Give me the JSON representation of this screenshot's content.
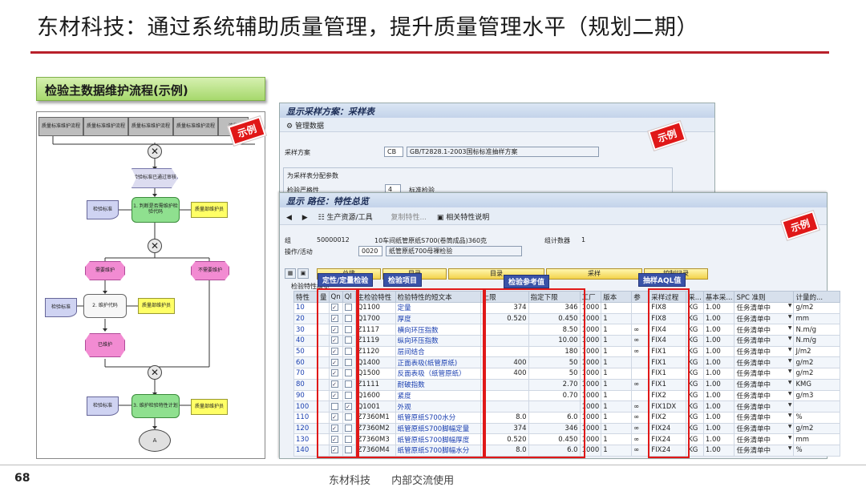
{
  "slide": {
    "title": "东材科技：通过系统辅助质量管理，提升质量管理水平（规划二期）",
    "section_label": "检验主数据维护流程(示例)",
    "page_number": "68",
    "footer_company": "东材科技",
    "footer_note": "内部交流使用",
    "accent_color": "#b8202a"
  },
  "stamp_text": "示例",
  "flowchart": {
    "top_events": [
      "质量标准维护流程",
      "质量标准维护流程",
      "质量标准维护流程",
      "质量标准维护流程",
      "流程"
    ],
    "start_event": "检验标准已通过审核",
    "func1": "1. 判断是否需维护检验代码",
    "doc1": "检验标准",
    "org1": "质量部维护员",
    "need_maintain": "需要维护",
    "no_maintain": "不需要维护",
    "func2": "2. 维护代码",
    "doc2": "检验标准",
    "org2": "质量部维护员",
    "maintained": "已维护",
    "func3": "3. 维护检验特性计划",
    "doc3": "检验标准",
    "org3": "质量部维护员",
    "end_connector": "A",
    "xor_symbol": "✕"
  },
  "sampling_window": {
    "title": "显示采样方案：采样表",
    "toolbar_item": "管理数据",
    "scheme_label": "采样方案",
    "scheme_code": "CB",
    "scheme_desc": "GB/T2828.1-2003国标标准抽样方案",
    "group_label": "为采样表分配参数",
    "severity_label": "检验严格性",
    "severity_code": "4",
    "severity_value": "标准检验"
  },
  "routing_window": {
    "title": "显示 路径：特性总览",
    "toolbar": {
      "prod_resources": "生产资源/工具",
      "copy_char": "复制特性...",
      "related_char": "相关特性说明"
    },
    "group_label": "组",
    "group_value": "50000012",
    "group_desc": "10车间纸管原纸S700(卷筒成品)360克",
    "counter_label": "组计数器",
    "counter_value": "1",
    "op_label": "操作/活动",
    "op_value": "0020",
    "op_desc": "纸管原纸700母裸检验",
    "button_general": "总揽",
    "button_catalog": "目录",
    "button_sampling": "采样",
    "button_control": "控制记录",
    "grid_section": "检验特性概览",
    "callouts": {
      "qual_quant": "定性/定量检验",
      "inspection_item": "检验项目",
      "ref_values": "检验参考值",
      "aql": "抽样AQL值"
    },
    "columns": [
      "特性",
      "量",
      "Qn",
      "Ql",
      "主检验特性",
      "检验特性的短文本",
      "上限",
      "指定下限",
      "工厂",
      "版本",
      "参",
      "采样过程",
      "采...",
      "基本采...",
      "SPC 准则",
      "计量的..."
    ],
    "rows": [
      {
        "id": "10",
        "qn": "✓",
        "ql": "",
        "code": "Q1100",
        "text": "定量",
        "upper": "374",
        "lower": "346",
        "plant": "1000",
        "ver": "1",
        "ref": "",
        "proc": "FIX8",
        "unit": "KG",
        "base": "1.00",
        "spc": "任务清单中",
        "meas": "g/m2"
      },
      {
        "id": "20",
        "qn": "✓",
        "ql": "",
        "code": "Q1700",
        "text": "厚度",
        "upper": "0.520",
        "lower": "0.450",
        "plant": "1000",
        "ver": "1",
        "ref": "",
        "proc": "FIX8",
        "unit": "KG",
        "base": "1.00",
        "spc": "任务清单中",
        "meas": "mm"
      },
      {
        "id": "30",
        "qn": "✓",
        "ql": "",
        "code": "Z1117",
        "text": "横向环压指数",
        "upper": "",
        "lower": "8.50",
        "plant": "1000",
        "ver": "1",
        "ref": "∞",
        "proc": "FIX4",
        "unit": "KG",
        "base": "1.00",
        "spc": "任务清单中",
        "meas": "N.m/g"
      },
      {
        "id": "40",
        "qn": "✓",
        "ql": "",
        "code": "Z1119",
        "text": "纵向环压指数",
        "upper": "",
        "lower": "10.00",
        "plant": "1000",
        "ver": "1",
        "ref": "∞",
        "proc": "FIX4",
        "unit": "KG",
        "base": "1.00",
        "spc": "任务清单中",
        "meas": "N.m/g"
      },
      {
        "id": "50",
        "qn": "✓",
        "ql": "",
        "code": "Z1120",
        "text": "层间结合",
        "upper": "",
        "lower": "180",
        "plant": "1000",
        "ver": "1",
        "ref": "∞",
        "proc": "FIX1",
        "unit": "KG",
        "base": "1.00",
        "spc": "任务清单中",
        "meas": "J/m2"
      },
      {
        "id": "60",
        "qn": "✓",
        "ql": "",
        "code": "Q1400",
        "text": "正面表吸(纸管原纸)",
        "upper": "400",
        "lower": "50",
        "plant": "1000",
        "ver": "1",
        "ref": "",
        "proc": "FIX1",
        "unit": "KG",
        "base": "1.00",
        "spc": "任务清单中",
        "meas": "g/m2"
      },
      {
        "id": "70",
        "qn": "✓",
        "ql": "",
        "code": "Q1500",
        "text": "反面表吸（纸管原纸）",
        "upper": "400",
        "lower": "50",
        "plant": "1000",
        "ver": "1",
        "ref": "",
        "proc": "FIX1",
        "unit": "KG",
        "base": "1.00",
        "spc": "任务清单中",
        "meas": "g/m2"
      },
      {
        "id": "80",
        "qn": "✓",
        "ql": "",
        "code": "Z1111",
        "text": "耐破指数",
        "upper": "",
        "lower": "2.70",
        "plant": "1000",
        "ver": "1",
        "ref": "∞",
        "proc": "FIX1",
        "unit": "KG",
        "base": "1.00",
        "spc": "任务清单中",
        "meas": "KMG"
      },
      {
        "id": "90",
        "qn": "✓",
        "ql": "",
        "code": "Q1600",
        "text": "紧度",
        "upper": "",
        "lower": "0.70",
        "plant": "1000",
        "ver": "1",
        "ref": "",
        "proc": "FIX2",
        "unit": "KG",
        "base": "1.00",
        "spc": "任务清单中",
        "meas": "g/m3"
      },
      {
        "id": "100",
        "qn": "",
        "ql": "✓",
        "code": "Q1001",
        "text": "外观",
        "upper": "",
        "lower": "",
        "plant": "1000",
        "ver": "1",
        "ref": "∞",
        "proc": "FIX1DX",
        "unit": "KG",
        "base": "1.00",
        "spc": "任务清单中",
        "meas": ""
      },
      {
        "id": "110",
        "qn": "✓",
        "ql": "",
        "code": "Z7360M1",
        "text": "纸管原纸S700水分",
        "upper": "8.0",
        "lower": "6.0",
        "plant": "1000",
        "ver": "1",
        "ref": "∞",
        "proc": "FIX2",
        "unit": "KG",
        "base": "1.00",
        "spc": "任务清单中",
        "meas": "%"
      },
      {
        "id": "120",
        "qn": "✓",
        "ql": "",
        "code": "Z7360M2",
        "text": "纸管原纸S700脚幅定量",
        "upper": "374",
        "lower": "346",
        "plant": "1000",
        "ver": "1",
        "ref": "∞",
        "proc": "FIX24",
        "unit": "KG",
        "base": "1.00",
        "spc": "任务清单中",
        "meas": "g/m2"
      },
      {
        "id": "130",
        "qn": "✓",
        "ql": "",
        "code": "Z7360M3",
        "text": "纸管原纸S700脚幅厚度",
        "upper": "0.520",
        "lower": "0.450",
        "plant": "1000",
        "ver": "1",
        "ref": "∞",
        "proc": "FIX24",
        "unit": "KG",
        "base": "1.00",
        "spc": "任务清单中",
        "meas": "mm"
      },
      {
        "id": "140",
        "qn": "✓",
        "ql": "",
        "code": "Z7360M4",
        "text": "纸管原纸S700脚幅水分",
        "upper": "8.0",
        "lower": "6.0",
        "plant": "1000",
        "ver": "1",
        "ref": "∞",
        "proc": "FIX24",
        "unit": "KG",
        "base": "1.00",
        "spc": "任务清单中",
        "meas": "%"
      }
    ]
  }
}
